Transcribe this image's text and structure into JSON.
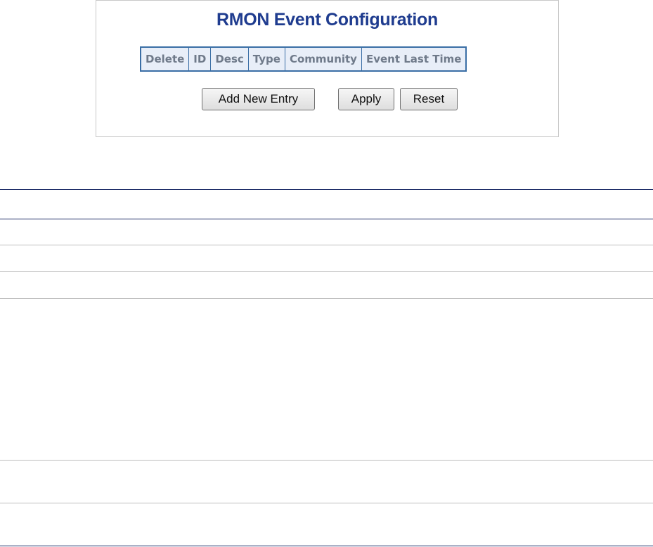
{
  "panel": {
    "title": "RMON Event Configuration",
    "table": {
      "columns": [
        "Delete",
        "ID",
        "Desc",
        "Type",
        "Community",
        "Event Last Time"
      ],
      "rows": []
    },
    "buttons": {
      "add_label": "Add New Entry",
      "apply_label": "Apply",
      "reset_label": "Reset"
    }
  },
  "colors": {
    "title": "#1f3c8f",
    "table_border": "#3a6ea5",
    "header_bg": "#e8eef8",
    "header_text": "#6f7a8a",
    "rule_dark": "#1b2a66",
    "rule_light": "#bdbdbd"
  }
}
